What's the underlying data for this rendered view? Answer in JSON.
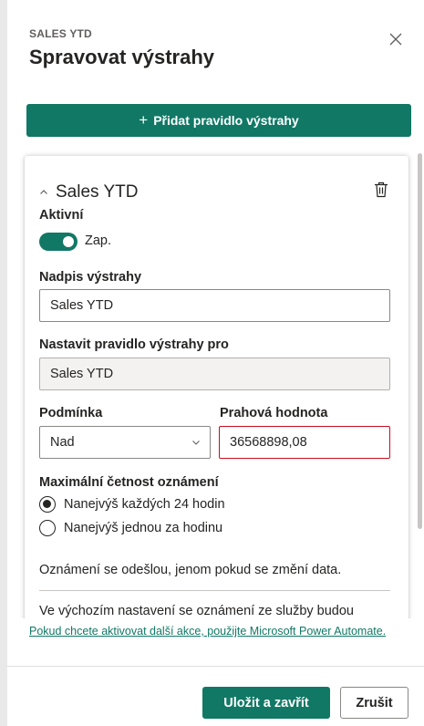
{
  "header": {
    "subtitle": "SALES YTD",
    "title": "Spravovat výstrahy",
    "close_icon": "close-icon"
  },
  "add_rule": {
    "icon": "plus",
    "label": "Přidat pravidlo výstrahy"
  },
  "rule": {
    "title": "Sales YTD",
    "expanded": true,
    "delete_icon": "trash-icon",
    "active": {
      "label": "Aktivní",
      "state_text": "Zap.",
      "on": true
    },
    "alert_title": {
      "label": "Nadpis výstrahy",
      "value": "Sales YTD"
    },
    "set_rule_for": {
      "label": "Nastavit pravidlo výstrahy pro",
      "value": "Sales YTD"
    },
    "condition": {
      "label": "Podmínka",
      "selected": "Nad"
    },
    "threshold": {
      "label": "Prahová hodnota",
      "value": "36568898,08"
    },
    "frequency": {
      "label": "Maximální četnost oznámení",
      "options": [
        {
          "label": "Nanejvýš každých 24 hodin",
          "selected": true
        },
        {
          "label": "Nanejvýš jednou za hodinu",
          "selected": false
        }
      ]
    },
    "info_text": "Oznámení se odešlou, jenom pokud se změní data.",
    "more_text": "Ve výchozím nastavení se oznámení ze služby budou"
  },
  "footer": {
    "link_text": "Pokud chcete aktivovat další akce, použijte Microsoft Power Automate.",
    "save_label": "Uložit a zavřít",
    "cancel_label": "Zrušit"
  },
  "colors": {
    "accent": "#117865",
    "error_border": "#c50f1f",
    "text": "#252423"
  }
}
